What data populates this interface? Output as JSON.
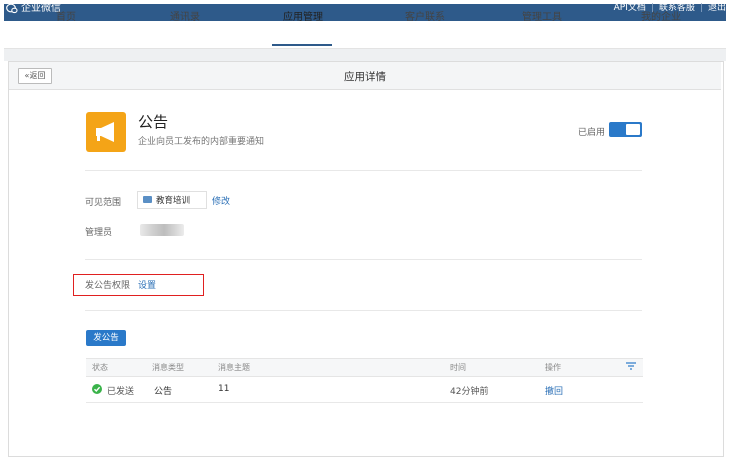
{
  "app": {
    "title": "企业微信"
  },
  "top_links": [
    "API文档",
    "联系客服",
    "退出"
  ],
  "nav": {
    "items": [
      "首页",
      "通讯录",
      "应用管理",
      "客户联系",
      "管理工具",
      "我的企业"
    ],
    "active": "应用管理"
  },
  "page": {
    "back_label": "«返回",
    "title": "应用详情"
  },
  "announcement_app": {
    "name": "公告",
    "description": "企业向员工发布的内部重要通知",
    "status_label": "已启用",
    "enabled": true
  },
  "visibility": {
    "label": "可见范围",
    "scope": "教育培训",
    "edit_label": "修改"
  },
  "admin": {
    "label": "管理员"
  },
  "permission": {
    "label": "发公告权限",
    "action": "设置"
  },
  "post_button": "发公告",
  "table": {
    "headers": [
      "状态",
      "消息类型",
      "消息主题",
      "时间",
      "操作"
    ],
    "rows": [
      {
        "status": "已发送",
        "type": "公告",
        "subject": "11",
        "time": "42分钟前",
        "action": "撤回"
      }
    ]
  },
  "colors": {
    "brand_bar": "#2e5a8a",
    "accent": "#2a79c9",
    "app_icon": "#f4a417",
    "highlight": "#e02020",
    "sent": "#3ab34a"
  }
}
